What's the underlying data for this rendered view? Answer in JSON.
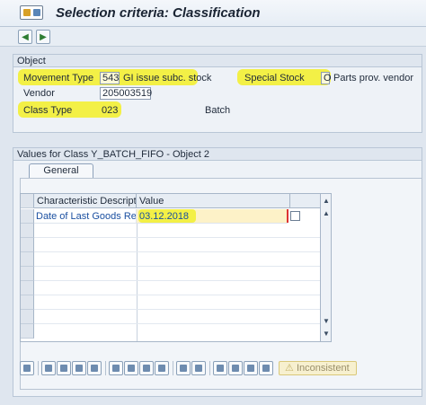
{
  "window": {
    "title": "Selection criteria: Classification"
  },
  "toolbar": {
    "buttons": [
      "back-icon",
      "forward-icon"
    ]
  },
  "object_group": {
    "title": "Object",
    "movement_type_label": "Movement Type",
    "movement_type_value": "543",
    "movement_type_desc": "GI issue subc. stock",
    "special_stock_label": "Special Stock",
    "special_stock_value": "O",
    "special_stock_desc": "Parts prov. vendor",
    "vendor_label": "Vendor",
    "vendor_value": "205003519",
    "class_type_label": "Class Type",
    "class_type_value": "023",
    "batch_label": "Batch"
  },
  "values_group": {
    "title": "Values for Class Y_BATCH_FIFO - Object 2",
    "tab_label": "General",
    "columns": [
      "Characteristic Description",
      "Value"
    ],
    "rows": [
      {
        "desc": "Date of Last Goods Recei...",
        "value": "03.12.2018"
      }
    ]
  },
  "bottom_toolbar": {
    "inconsistent_label": "Inconsistent"
  },
  "colors": {
    "highlight": "#f3f046",
    "background": "#dfe6ef",
    "link_text": "#1a4fa0"
  }
}
